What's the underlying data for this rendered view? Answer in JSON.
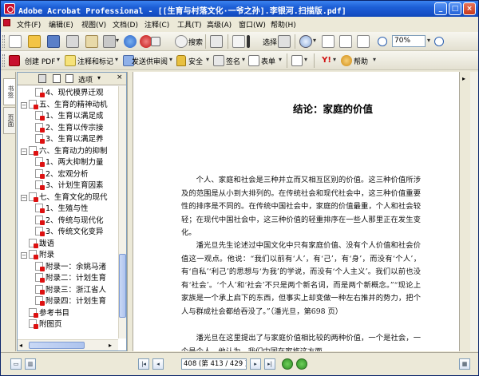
{
  "window": {
    "title": "Adobe Acrobat Professional - [[生育与村落文化·一爷之孙].李银河.扫描版.pdf]",
    "minimize": "_",
    "maximize": "□",
    "close": "×"
  },
  "menu": [
    "文件(F)",
    "编辑(E)",
    "视图(V)",
    "文档(D)",
    "注释(C)",
    "工具(T)",
    "高级(A)",
    "窗口(W)",
    "帮助(H)"
  ],
  "toolbar1": {
    "search_label": "搜索",
    "select_label": "选择",
    "zoom_value": "70%"
  },
  "toolbar2": {
    "create_pdf": "创建 PDF",
    "comment_markup": "注释和标记",
    "send_review": "发送供审阅",
    "security": "安全",
    "sign": "签名",
    "forms": "表单",
    "help": "帮助"
  },
  "navtabs": [
    "书签",
    "页面"
  ],
  "bookmarks": {
    "options_label": "选项",
    "items": [
      {
        "level": 2,
        "text": "4、现代模界迁观",
        "toggle": ""
      },
      {
        "level": 1,
        "text": "五、生育的精神动机",
        "toggle": "−"
      },
      {
        "level": 2,
        "text": "1、生育以满足成",
        "toggle": ""
      },
      {
        "level": 2,
        "text": "2、生育以传宗接",
        "toggle": ""
      },
      {
        "level": 2,
        "text": "3、生育以满足养",
        "toggle": ""
      },
      {
        "level": 1,
        "text": "六、生育动力的抑制",
        "toggle": "−"
      },
      {
        "level": 2,
        "text": "1、两大抑制力量",
        "toggle": ""
      },
      {
        "level": 2,
        "text": "2、宏观分析",
        "toggle": ""
      },
      {
        "level": 2,
        "text": "3、计划生育因素",
        "toggle": ""
      },
      {
        "level": 1,
        "text": "七、生育文化的现代",
        "toggle": "−"
      },
      {
        "level": 2,
        "text": "1、生殖与性",
        "toggle": ""
      },
      {
        "level": 2,
        "text": "2、传统与现代化",
        "toggle": ""
      },
      {
        "level": 2,
        "text": "3、传统文化变异",
        "toggle": ""
      },
      {
        "level": 1,
        "text": "跋语",
        "toggle": ""
      },
      {
        "level": 1,
        "text": "附录",
        "toggle": "−"
      },
      {
        "level": 2,
        "text": "附录一：余姚马渚",
        "toggle": ""
      },
      {
        "level": 2,
        "text": "附录二：计划生育",
        "toggle": ""
      },
      {
        "level": 2,
        "text": "附录三：浙江省人",
        "toggle": ""
      },
      {
        "level": 2,
        "text": "附录四：计划生育",
        "toggle": ""
      },
      {
        "level": 1,
        "text": "参考书目",
        "toggle": ""
      },
      {
        "level": 1,
        "text": "附图页",
        "toggle": ""
      }
    ]
  },
  "document": {
    "heading": "结论：家庭的价值",
    "para1": "个人、家庭和社会是三种并立而又相互区别的价值。这三种价值所涉及的范围是从小到大排列的。在传统社会和现代社会中，这三种价值重要性的排序是不同的。在传统中国社会中，家庭的价值最重，个人和社会较轻；在现代中国社会中，这三种价值的轻重排序在一些人那里正在发生变化。",
    "para2": "潘光旦先生论述过中国文化中只有家庭价值、没有个人价值和社会价值这一观点。他说：“我们以前有‘人’，有‘己’，有‘身’，而没有‘个人’，有‘自私’‘利己’的思想与‘为我’的学说，而没有‘个人主义’。我们以前也没有‘社会’。‘个人’和‘社会’不只是两个新名词，而是两个新概念。”“现论上家族是一个承上启下的东西，但事实上却变做一种左右推并的势力，把个人与群成社会都给吞没了。”（潘光旦，第698 页）",
    "para3": "潘光旦在这里提出了与家庭价值相比较的两种价值，一个是社会，一个是个人。他认为，我们中国在家族这方面"
  },
  "status": {
    "page_indicator": "408 (第 413 / 429 页)"
  }
}
